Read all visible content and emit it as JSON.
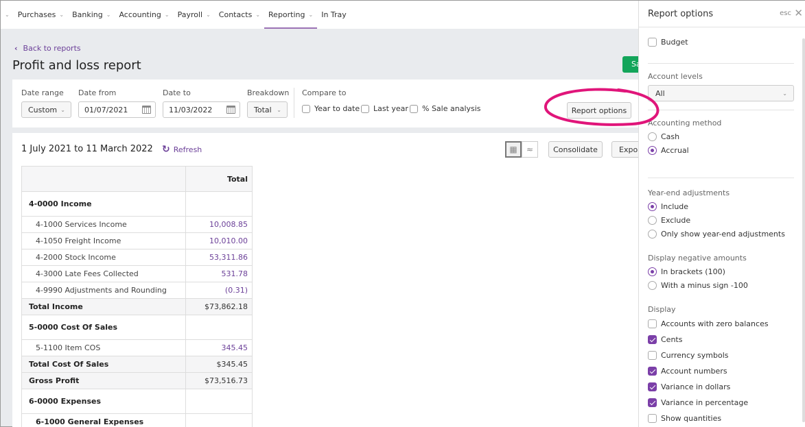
{
  "nav": {
    "items": [
      {
        "label": "Purchases",
        "has_menu": true,
        "active": false
      },
      {
        "label": "Banking",
        "has_menu": true,
        "active": false
      },
      {
        "label": "Accounting",
        "has_menu": true,
        "active": false
      },
      {
        "label": "Payroll",
        "has_menu": true,
        "active": false
      },
      {
        "label": "Contacts",
        "has_menu": true,
        "active": false
      },
      {
        "label": "Reporting",
        "has_menu": true,
        "active": true
      },
      {
        "label": "In Tray",
        "has_menu": false,
        "active": false
      }
    ]
  },
  "header": {
    "back_label": "Back to reports",
    "title": "Profit and loss report",
    "save_label": "Sa"
  },
  "filters": {
    "date_range_label": "Date range",
    "date_range_value": "Custom",
    "date_from_label": "Date from",
    "date_from_value": "01/07/2021",
    "date_to_label": "Date to",
    "date_to_value": "11/03/2022",
    "breakdown_label": "Breakdown",
    "breakdown_value": "Total",
    "compare_label": "Compare to",
    "compare_options": [
      {
        "label": "Year to date",
        "checked": false
      },
      {
        "label": "Last year",
        "checked": false
      },
      {
        "label": "% Sale analysis",
        "checked": false
      }
    ],
    "report_options_label": "Report options"
  },
  "report": {
    "range": "1 July 2021 to 11 March 2022",
    "refresh_label": "Refresh",
    "consolidate_label": "Consolidate",
    "export_label": "Expor",
    "column_header": "Total",
    "rows": [
      {
        "type": "group",
        "account": "4-0000 Income",
        "amount": ""
      },
      {
        "type": "sub",
        "account": "4-1000 Services Income",
        "amount": "10,008.85"
      },
      {
        "type": "sub",
        "account": "4-1050 Freight Income",
        "amount": "10,010.00"
      },
      {
        "type": "sub",
        "account": "4-2000 Stock Income",
        "amount": "53,311.86"
      },
      {
        "type": "sub",
        "account": "4-3000 Late Fees Collected",
        "amount": "531.78"
      },
      {
        "type": "sub",
        "account": "4-9990 Adjustments and Rounding",
        "amount": "(0.31)"
      },
      {
        "type": "total",
        "account": "Total Income",
        "amount": "$73,862.18"
      },
      {
        "type": "group",
        "account": "5-0000 Cost Of Sales",
        "amount": ""
      },
      {
        "type": "sub",
        "account": "5-1100 Item COS",
        "amount": "345.45"
      },
      {
        "type": "total",
        "account": "Total Cost Of Sales",
        "amount": "$345.45"
      },
      {
        "type": "total",
        "account": "Gross Profit",
        "amount": "$73,516.73"
      },
      {
        "type": "group",
        "account": "6-0000 Expenses",
        "amount": ""
      },
      {
        "type": "subgroup",
        "account": "6-1000 General Expenses",
        "amount": ""
      }
    ]
  },
  "panel": {
    "title": "Report options",
    "esc_label": "esc",
    "budget": {
      "label": "Budget",
      "checked": false
    },
    "account_levels": {
      "label": "Account levels",
      "value": "All"
    },
    "accounting_method": {
      "label": "Accounting method",
      "options": [
        {
          "label": "Cash",
          "selected": false
        },
        {
          "label": "Accrual",
          "selected": true
        }
      ]
    },
    "year_end": {
      "label": "Year-end adjustments",
      "options": [
        {
          "label": "Include",
          "selected": true
        },
        {
          "label": "Exclude",
          "selected": false
        },
        {
          "label": "Only show year-end adjustments",
          "selected": false
        }
      ]
    },
    "negative": {
      "label": "Display negative amounts",
      "options": [
        {
          "label": "In brackets (100)",
          "selected": true
        },
        {
          "label": "With a minus sign -100",
          "selected": false
        }
      ]
    },
    "display": {
      "label": "Display",
      "options": [
        {
          "label": "Accounts with zero balances",
          "checked": false
        },
        {
          "label": "Cents",
          "checked": true
        },
        {
          "label": "Currency symbols",
          "checked": false
        },
        {
          "label": "Account numbers",
          "checked": true
        },
        {
          "label": "Variance in dollars",
          "checked": true
        },
        {
          "label": "Variance in percentage",
          "checked": true
        },
        {
          "label": "Show quantities",
          "checked": false
        }
      ]
    }
  },
  "colors": {
    "accent": "#6b3f98",
    "save_green": "#13a55a",
    "annotation": "#e0157a"
  }
}
